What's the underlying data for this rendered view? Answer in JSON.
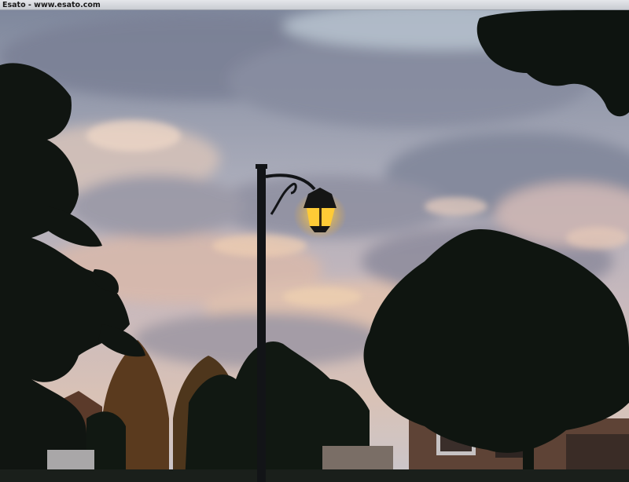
{
  "watermark": {
    "text": "Esato - www.esato.com"
  },
  "photo": {
    "subject": "street lamp at dusk",
    "colors": {
      "sky_top": "#8a93a8",
      "sky_mid": "#b5b2bc",
      "sky_glow": "#e9c3a8",
      "cloud_dark": "#7d8296",
      "foliage": "#101712",
      "lamp_light": "#ffcc3a",
      "house_brick": "#6b4a3a"
    }
  }
}
